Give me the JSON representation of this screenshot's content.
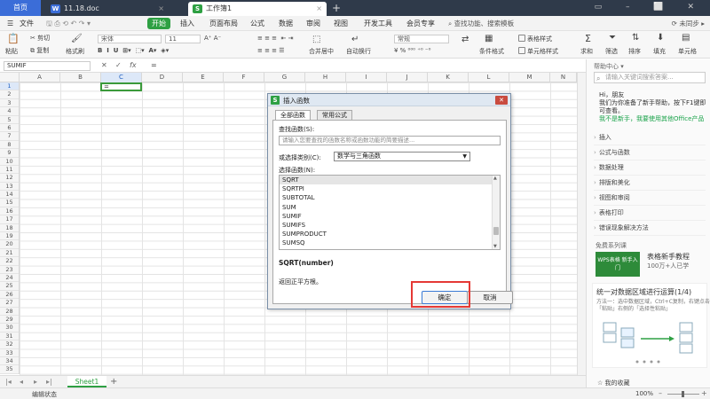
{
  "tabs": {
    "home": "首页",
    "doc": "11.18.doc",
    "doc_icon": "W",
    "workbook": "工作簿1",
    "workbook_icon": "S",
    "close": "×",
    "new": "+"
  },
  "window": {
    "controls": "▭ – ⬜ ✕"
  },
  "menu": {
    "file": "文件",
    "start": "开始",
    "items": [
      "插入",
      "页面布局",
      "公式",
      "数据",
      "审阅",
      "视图",
      "开发工具",
      "会员专享"
    ],
    "search": "查找功能、搜索模板",
    "right": "⟳ 未同步 ▸"
  },
  "ribbon": {
    "cut": "剪切",
    "copy": "复制",
    "paste": "粘贴",
    "format_painter": "格式刷",
    "font": "宋体",
    "font_size": "11",
    "merge": "合并居中",
    "wrap": "自动换行",
    "number_format": "常规",
    "cond_format": "条件格式",
    "table_style": "表格样式",
    "cell_style": "单元格样式",
    "sum": "求和",
    "filter": "筛选",
    "sort": "排序",
    "fill": "填充",
    "cell": "单元格"
  },
  "formula_bar": {
    "name_box": "SUMIF",
    "cancel": "✕",
    "confirm": "✓",
    "fx": "fx",
    "content": "="
  },
  "grid": {
    "columns": [
      "A",
      "B",
      "C",
      "D",
      "E",
      "F",
      "G",
      "H",
      "I",
      "J",
      "K",
      "L",
      "M",
      "N"
    ],
    "rows": [
      "1",
      "2",
      "3",
      "4",
      "5",
      "6",
      "7",
      "8",
      "9",
      "10",
      "11",
      "12",
      "13",
      "14",
      "15",
      "16",
      "17",
      "18",
      "19",
      "20",
      "21",
      "22",
      "23",
      "24",
      "25",
      "26",
      "27",
      "28",
      "29",
      "30",
      "31",
      "32",
      "33",
      "34",
      "35"
    ],
    "selected_column": "C",
    "selected_row": "1",
    "active_cell_value": "="
  },
  "sheets": {
    "nav": [
      "|◂",
      "◂",
      "▸",
      "▸|"
    ],
    "active": "Sheet1",
    "add": "+"
  },
  "status": {
    "mode": "编辑状态",
    "zoom": "100%",
    "minus": "–",
    "plus": "+"
  },
  "help_pane": {
    "title": "帮助中心 ▾",
    "search_placeholder": "请输入关键词搜索答案...",
    "greeting": "Hi，朋友",
    "message": "我们为你准备了新手帮助，按下F1键即可查看。",
    "link": "我不是新手，我要使用其他Office产品",
    "categories": [
      "插入",
      "公式与函数",
      "数据处理",
      "排版和美化",
      "视图和审阅",
      "表格打印",
      "错误现象解决方法"
    ],
    "free_course": "免费系列课",
    "course_thumb": "WPS表格 新手入门",
    "course_title": "表格新手教程",
    "course_sub": "100万+人已学",
    "article_title": "统一对数据区域进行运算(1/4)",
    "article_body": "方法一：选中数据区域，Ctrl+C复制，右键点击「粘贴」右侧的「选择性粘贴」",
    "fav": "☆ 我的收藏"
  },
  "dialog": {
    "icon": "S",
    "title": "插入函数",
    "close": "✕",
    "tab_all": "全部函数",
    "tab_common": "常用公式",
    "find_label": "查找函数(S):",
    "find_placeholder": "请输入您要查找的函数名称或函数功能的简要描述...",
    "category_label": "或选择类别(C):",
    "category_value": "数学与三角函数",
    "select_label": "选择函数(N):",
    "functions": [
      "SQRT",
      "SQRTPI",
      "SUBTOTAL",
      "SUM",
      "SUMIF",
      "SUMIFS",
      "SUMPRODUCT",
      "SUMSQ"
    ],
    "selected_function": "SQRT",
    "signature": "SQRT(number)",
    "description": "返回正平方根。",
    "ok": "确定",
    "cancel": "取消"
  },
  "colors": {
    "accent": "#2ea043",
    "highlight": "#e53935",
    "tabbar": "#2f3a4a",
    "home_tab": "#3b6dd8"
  }
}
